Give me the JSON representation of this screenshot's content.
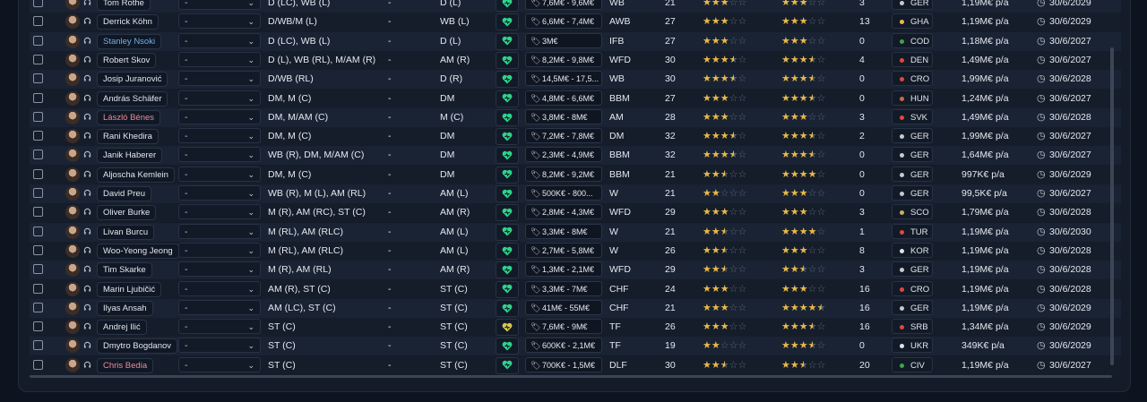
{
  "colors": {
    "background": "#0d1420",
    "panel": "#141c29",
    "star": "#e8b94a",
    "mood_good": "#2dd38a",
    "mood_ok": "#d6c84a"
  },
  "icons": {
    "checkbox": "checkbox-icon",
    "avatar": "player-photo",
    "headphones": "headphones-icon",
    "chevron": "chevron-down-icon",
    "mood": "heart-icon",
    "tag": "price-tag-icon",
    "clock": "contract-clock-icon"
  },
  "players": [
    {
      "name": "Tom Rothe",
      "sel": "-",
      "positions": "D (LC), WB (L)",
      "dash": "-",
      "role": "D (L)",
      "mood": "good",
      "value": "7,6M€ - 9,6M€",
      "prole": "WB",
      "age": "21",
      "s1": [
        1,
        1,
        1,
        0,
        0
      ],
      "s2": [
        1,
        1,
        1,
        0,
        0
      ],
      "apps": "3",
      "nation": "GER",
      "natc": "#c9c9c9",
      "wage": "1,19M€ p/a",
      "expiry": "30/6/2029",
      "ncls": ""
    },
    {
      "name": "Derrick Köhn",
      "sel": "-",
      "positions": "D/WB/M (L)",
      "dash": "-",
      "role": "WB (L)",
      "mood": "good",
      "value": "6,6M€ - 7,4M€",
      "prole": "AWB",
      "age": "27",
      "s1": [
        1,
        1,
        1,
        0,
        0
      ],
      "s2": [
        1,
        1,
        1,
        0,
        0
      ],
      "apps": "13",
      "nation": "GHA",
      "natc": "#e8b94a",
      "wage": "1,19M€ p/a",
      "expiry": "30/6/2029",
      "ncls": ""
    },
    {
      "name": "Stanley Nsoki",
      "sel": "-",
      "positions": "D (LC), WB (L)",
      "dash": "-",
      "role": "D (L)",
      "mood": "good",
      "value": "3M€",
      "prole": "IFB",
      "age": "27",
      "s1": [
        1,
        1,
        1,
        0,
        0
      ],
      "s2": [
        1,
        1,
        1,
        0,
        0
      ],
      "apps": "0",
      "nation": "COD",
      "natc": "#3fa34d",
      "wage": "1,18M€ p/a",
      "expiry": "30/6/2027",
      "ncls": "blue"
    },
    {
      "name": "Robert Skov",
      "sel": "-",
      "positions": "D (L), WB (RL), M/AM (R)",
      "dash": "-",
      "role": "AM (R)",
      "mood": "good",
      "value": "8,2M€ - 9,8M€",
      "prole": "WFD",
      "age": "30",
      "s1": [
        1,
        1,
        1,
        0.5,
        0
      ],
      "s2": [
        1,
        1,
        1,
        0.5,
        0
      ],
      "apps": "4",
      "nation": "DEN",
      "natc": "#e0473f",
      "wage": "1,49M€ p/a",
      "expiry": "30/6/2027",
      "ncls": ""
    },
    {
      "name": "Josip Juranović",
      "sel": "-",
      "positions": "D/WB (RL)",
      "dash": "-",
      "role": "D (R)",
      "mood": "good",
      "value": "14,5M€ - 17,5...",
      "prole": "WB",
      "age": "30",
      "s1": [
        1,
        1,
        1,
        0.5,
        0
      ],
      "s2": [
        1,
        1,
        1,
        0.5,
        0
      ],
      "apps": "0",
      "nation": "CRO",
      "natc": "#e0473f",
      "wage": "1,99M€ p/a",
      "expiry": "30/6/2028",
      "ncls": ""
    },
    {
      "name": "András Schäfer",
      "sel": "-",
      "positions": "DM, M (C)",
      "dash": "-",
      "role": "DM",
      "mood": "good",
      "value": "4,8M€ - 6,6M€",
      "prole": "BBM",
      "age": "27",
      "s1": [
        1,
        1,
        1,
        0,
        0
      ],
      "s2": [
        1,
        1,
        1,
        0.5,
        0
      ],
      "apps": "0",
      "nation": "HUN",
      "natc": "#c96a4a",
      "wage": "1,24M€ p/a",
      "expiry": "30/6/2027",
      "ncls": ""
    },
    {
      "name": "László Bénes",
      "sel": "-",
      "positions": "DM, M/AM (C)",
      "dash": "-",
      "role": "M (C)",
      "mood": "good",
      "value": "3,8M€ - 8M€",
      "prole": "AM",
      "age": "28",
      "s1": [
        1,
        1,
        1,
        0,
        0
      ],
      "s2": [
        1,
        1,
        1,
        0,
        0
      ],
      "apps": "3",
      "nation": "SVK",
      "natc": "#e0473f",
      "wage": "1,49M€ p/a",
      "expiry": "30/6/2028",
      "ncls": "red"
    },
    {
      "name": "Rani Khedira",
      "sel": "-",
      "positions": "DM, M (C)",
      "dash": "-",
      "role": "DM",
      "mood": "good",
      "value": "7,2M€ - 7,8M€",
      "prole": "DM",
      "age": "32",
      "s1": [
        1,
        1,
        1,
        0.5,
        0
      ],
      "s2": [
        1,
        1,
        1,
        0.5,
        0
      ],
      "apps": "2",
      "nation": "GER",
      "natc": "#c9c9c9",
      "wage": "1,99M€ p/a",
      "expiry": "30/6/2027",
      "ncls": ""
    },
    {
      "name": "Janik Haberer",
      "sel": "-",
      "positions": "WB (R), DM, M/AM (C)",
      "dash": "-",
      "role": "DM",
      "mood": "good",
      "value": "2,3M€ - 4,9M€",
      "prole": "BBM",
      "age": "32",
      "s1": [
        1,
        1,
        1,
        0.5,
        0
      ],
      "s2": [
        1,
        1,
        1,
        0.5,
        0
      ],
      "apps": "0",
      "nation": "GER",
      "natc": "#c9c9c9",
      "wage": "1,64M€ p/a",
      "expiry": "30/6/2027",
      "ncls": ""
    },
    {
      "name": "Aljoscha Kemlein",
      "sel": "-",
      "positions": "DM, M (C)",
      "dash": "-",
      "role": "DM",
      "mood": "good",
      "value": "8,2M€ - 9,2M€",
      "prole": "BBM",
      "age": "21",
      "s1": [
        1,
        1,
        0.5,
        0,
        0
      ],
      "s2": [
        1,
        1,
        1,
        1,
        0
      ],
      "apps": "0",
      "nation": "GER",
      "natc": "#c9c9c9",
      "wage": "997K€ p/a",
      "expiry": "30/6/2029",
      "ncls": ""
    },
    {
      "name": "David Preu",
      "sel": "-",
      "positions": "WB (R), M (L), AM (RL)",
      "dash": "-",
      "role": "AM (L)",
      "mood": "good",
      "value": "500K€ - 800...",
      "prole": "W",
      "age": "21",
      "s1": [
        1,
        1,
        0,
        0,
        0
      ],
      "s2": [
        1,
        1,
        1,
        0,
        0
      ],
      "apps": "0",
      "nation": "GER",
      "natc": "#c9c9c9",
      "wage": "99,5K€ p/a",
      "expiry": "30/6/2027",
      "ncls": ""
    },
    {
      "name": "Oliver Burke",
      "sel": "-",
      "positions": "M (R), AM (RC), ST (C)",
      "dash": "-",
      "role": "AM (R)",
      "mood": "good",
      "value": "2,8M€ - 4,3M€",
      "prole": "WFD",
      "age": "29",
      "s1": [
        1,
        1,
        1,
        0,
        0
      ],
      "s2": [
        1,
        1,
        1,
        0,
        0
      ],
      "apps": "3",
      "nation": "SCO",
      "natc": "#c9b062",
      "wage": "1,79M€ p/a",
      "expiry": "30/6/2028",
      "ncls": ""
    },
    {
      "name": "Livan Burcu",
      "sel": "-",
      "positions": "M (RL), AM (RLC)",
      "dash": "-",
      "role": "AM (L)",
      "mood": "good",
      "value": "3,3M€ - 8M€",
      "prole": "W",
      "age": "21",
      "s1": [
        1,
        1,
        0.5,
        0,
        0
      ],
      "s2": [
        1,
        1,
        1,
        1,
        0
      ],
      "apps": "1",
      "nation": "TUR",
      "natc": "#e0473f",
      "wage": "1,19M€ p/a",
      "expiry": "30/6/2030",
      "ncls": ""
    },
    {
      "name": "Woo-Yeong Jeong",
      "sel": "-",
      "positions": "M (RL), AM (RLC)",
      "dash": "-",
      "role": "AM (L)",
      "mood": "good",
      "value": "2,7M€ - 5,8M€",
      "prole": "W",
      "age": "26",
      "s1": [
        1,
        1,
        0.5,
        0,
        0
      ],
      "s2": [
        1,
        1,
        1,
        0,
        0
      ],
      "apps": "8",
      "nation": "KOR",
      "natc": "#dfe3ea",
      "wage": "1,19M€ p/a",
      "expiry": "30/6/2028",
      "ncls": ""
    },
    {
      "name": "Tim Skarke",
      "sel": "-",
      "positions": "M (R), AM (RL)",
      "dash": "-",
      "role": "AM (R)",
      "mood": "good",
      "value": "1,3M€ - 2,1M€",
      "prole": "WFD",
      "age": "29",
      "s1": [
        1,
        1,
        0.5,
        0,
        0
      ],
      "s2": [
        1,
        1,
        0.5,
        0,
        0
      ],
      "apps": "3",
      "nation": "GER",
      "natc": "#c9c9c9",
      "wage": "1,19M€ p/a",
      "expiry": "30/6/2028",
      "ncls": ""
    },
    {
      "name": "Marin Ljubičić",
      "sel": "-",
      "positions": "AM (R), ST (C)",
      "dash": "-",
      "role": "ST (C)",
      "mood": "good",
      "value": "3,3M€ - 7M€",
      "prole": "CHF",
      "age": "24",
      "s1": [
        1,
        1,
        1,
        0,
        0
      ],
      "s2": [
        1,
        1,
        1,
        0,
        0
      ],
      "apps": "16",
      "nation": "CRO",
      "natc": "#e0473f",
      "wage": "1,19M€ p/a",
      "expiry": "30/6/2028",
      "ncls": ""
    },
    {
      "name": "Ilyas Ansah",
      "sel": "-",
      "positions": "AM (LC), ST (C)",
      "dash": "-",
      "role": "ST (C)",
      "mood": "good",
      "value": "41M€ - 55M€",
      "prole": "CHF",
      "age": "21",
      "s1": [
        1,
        1,
        1,
        0,
        0
      ],
      "s2": [
        1,
        1,
        1,
        1,
        0.5
      ],
      "apps": "16",
      "nation": "GER",
      "natc": "#c9c9c9",
      "wage": "1,19M€ p/a",
      "expiry": "30/6/2029",
      "ncls": ""
    },
    {
      "name": "Andrej Ilić",
      "sel": "-",
      "positions": "ST (C)",
      "dash": "-",
      "role": "ST (C)",
      "mood": "ok",
      "value": "7,6M€ - 9M€",
      "prole": "TF",
      "age": "26",
      "s1": [
        1,
        1,
        1,
        0,
        0
      ],
      "s2": [
        1,
        1,
        1,
        0.5,
        0
      ],
      "apps": "16",
      "nation": "SRB",
      "natc": "#e0473f",
      "wage": "1,34M€ p/a",
      "expiry": "30/6/2029",
      "ncls": ""
    },
    {
      "name": "Dmytro Bogdanov",
      "sel": "-",
      "positions": "ST (C)",
      "dash": "-",
      "role": "ST (C)",
      "mood": "good",
      "value": "600K€ - 2,1M€",
      "prole": "TF",
      "age": "19",
      "s1": [
        1,
        1,
        0,
        0,
        0
      ],
      "s2": [
        1,
        1,
        1,
        0.5,
        0
      ],
      "apps": "0",
      "nation": "UKR",
      "natc": "#dfe3ea",
      "wage": "349K€ p/a",
      "expiry": "30/6/2029",
      "ncls": ""
    },
    {
      "name": "Chris Bedia",
      "sel": "-",
      "positions": "ST (C)",
      "dash": "-",
      "role": "ST (C)",
      "mood": "good",
      "value": "700K€ - 1,5M€",
      "prole": "DLF",
      "age": "30",
      "s1": [
        1,
        1,
        0.5,
        0,
        0
      ],
      "s2": [
        1,
        1,
        0.5,
        0,
        0
      ],
      "apps": "20",
      "nation": "CIV",
      "natc": "#3fa34d",
      "wage": "1,19M€ p/a",
      "expiry": "30/6/2027",
      "ncls": "red"
    }
  ]
}
